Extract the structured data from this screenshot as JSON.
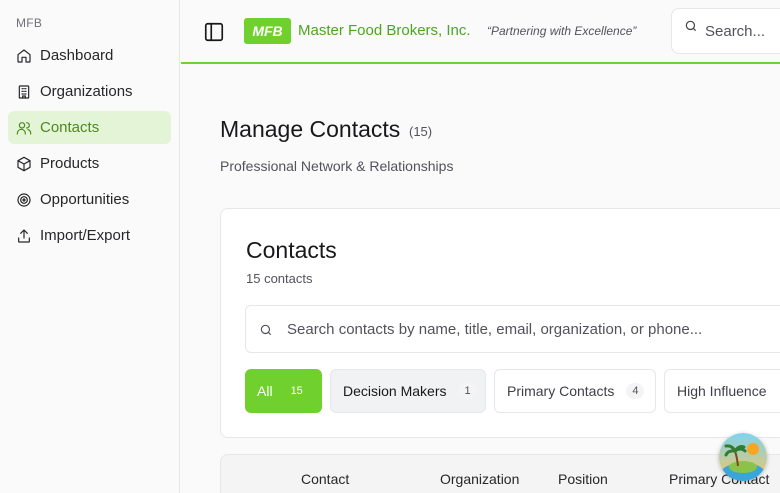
{
  "sidebar": {
    "brand": "MFB",
    "items": [
      {
        "label": "Dashboard",
        "icon": "home-icon"
      },
      {
        "label": "Organizations",
        "icon": "building-icon"
      },
      {
        "label": "Contacts",
        "icon": "users-icon"
      },
      {
        "label": "Products",
        "icon": "package-icon"
      },
      {
        "label": "Opportunities",
        "icon": "target-icon"
      },
      {
        "label": "Import/Export",
        "icon": "upload-icon"
      }
    ],
    "active": "Contacts"
  },
  "header": {
    "logo": "MFB",
    "company": "Master Food Brokers, Inc.",
    "tagline": "“Partnering with Excellence”",
    "search_placeholder": "Search..."
  },
  "page": {
    "title": "Manage Contacts",
    "count": "(15)",
    "subtitle": "Professional Network & Relationships"
  },
  "card": {
    "title": "Contacts",
    "count": "15 contacts",
    "search_placeholder": "Search contacts by name, title, email, organization, or phone...",
    "filters": [
      {
        "label": "All",
        "count": "15"
      },
      {
        "label": "Decision Makers",
        "count": "1"
      },
      {
        "label": "Primary Contacts",
        "count": "4"
      },
      {
        "label": "High Influence",
        "count": ""
      }
    ]
  },
  "table": {
    "columns": [
      "Contact",
      "Organization",
      "Position",
      "Primary Contact"
    ]
  },
  "colors": {
    "accent": "#6fd02e",
    "active_bg": "#e3f5d6",
    "brand_text": "#4da61e"
  }
}
